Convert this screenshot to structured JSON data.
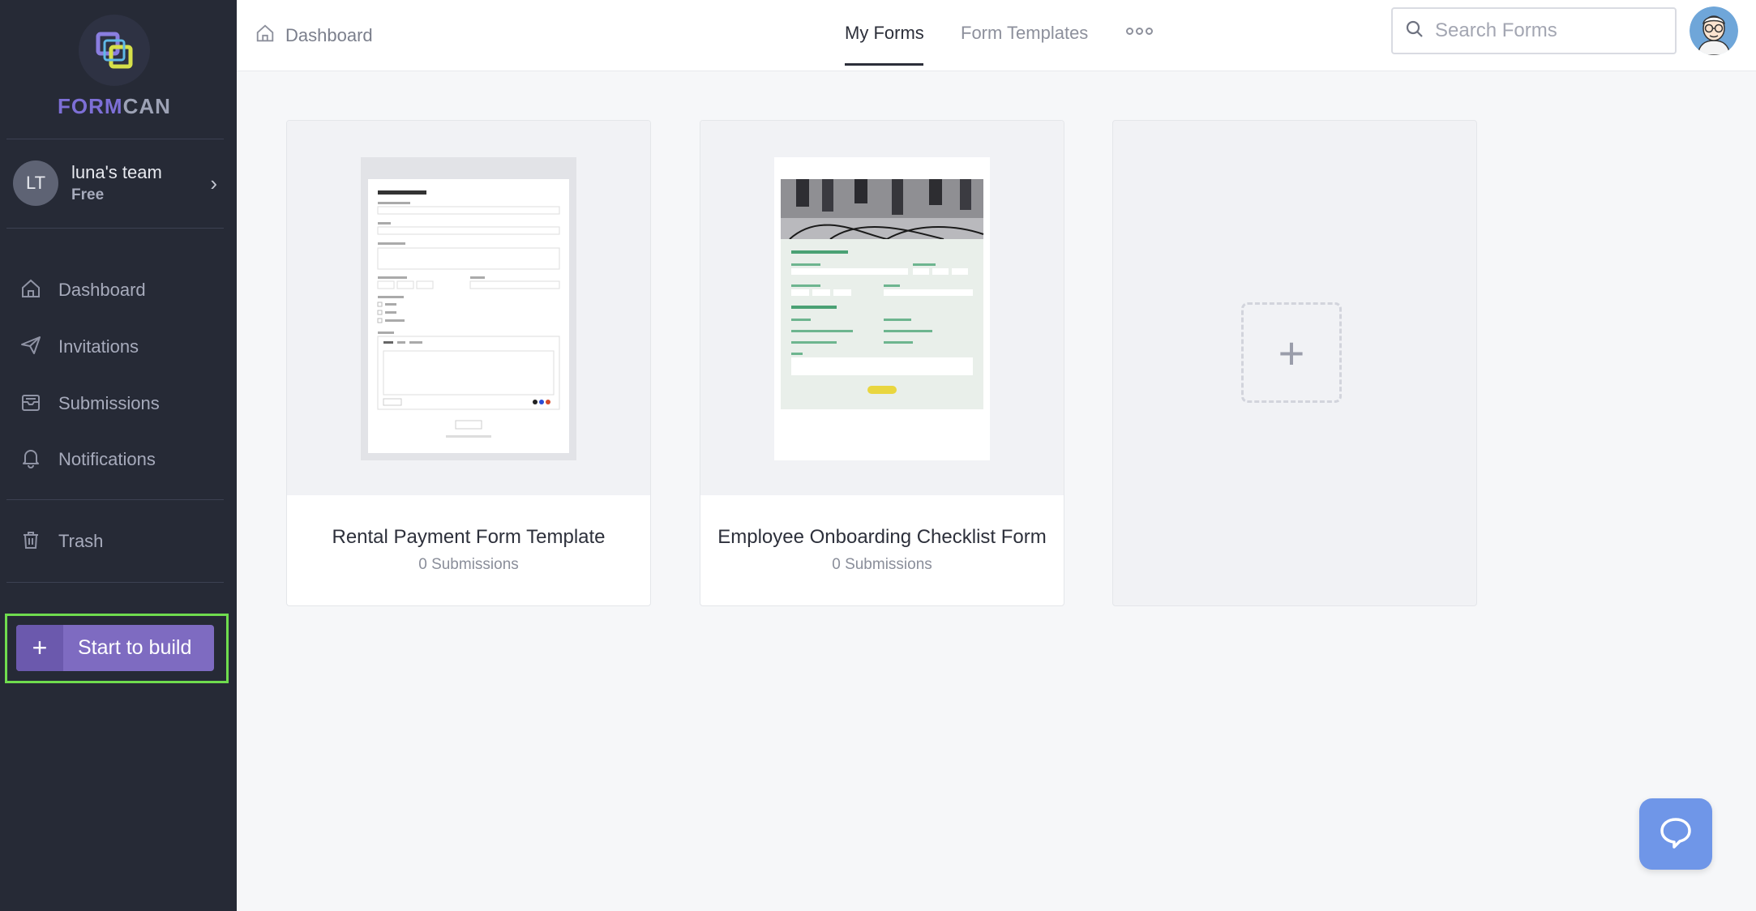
{
  "brand": {
    "name_part1": "FORM",
    "name_part2": "CAN"
  },
  "team": {
    "initials": "LT",
    "name": "luna's team",
    "plan": "Free"
  },
  "sidebar": {
    "items": [
      {
        "label": "Dashboard",
        "icon": "home-icon"
      },
      {
        "label": "Invitations",
        "icon": "paper-plane-icon"
      },
      {
        "label": "Submissions",
        "icon": "inbox-icon"
      },
      {
        "label": "Notifications",
        "icon": "bell-icon"
      },
      {
        "label": "Trash",
        "icon": "trash-icon"
      }
    ],
    "build_button": {
      "label": "Start to build",
      "icon": "+"
    }
  },
  "header": {
    "breadcrumb": "Dashboard",
    "tabs": [
      {
        "label": "My Forms",
        "active": true
      },
      {
        "label": "Form Templates",
        "active": false
      }
    ],
    "search_placeholder": "Search Forms"
  },
  "forms": [
    {
      "title": "Rental Payment Form Template",
      "submissions": "0 Submissions"
    },
    {
      "title": "Employee Onboarding Checklist Form",
      "submissions": "0 Submissions"
    }
  ],
  "new_form_icon": "+",
  "colors": {
    "sidebar_bg": "#262a36",
    "accent": "#7e6bc1",
    "highlight_outline": "#6fdc4e",
    "chat_button": "#6f96e8"
  }
}
